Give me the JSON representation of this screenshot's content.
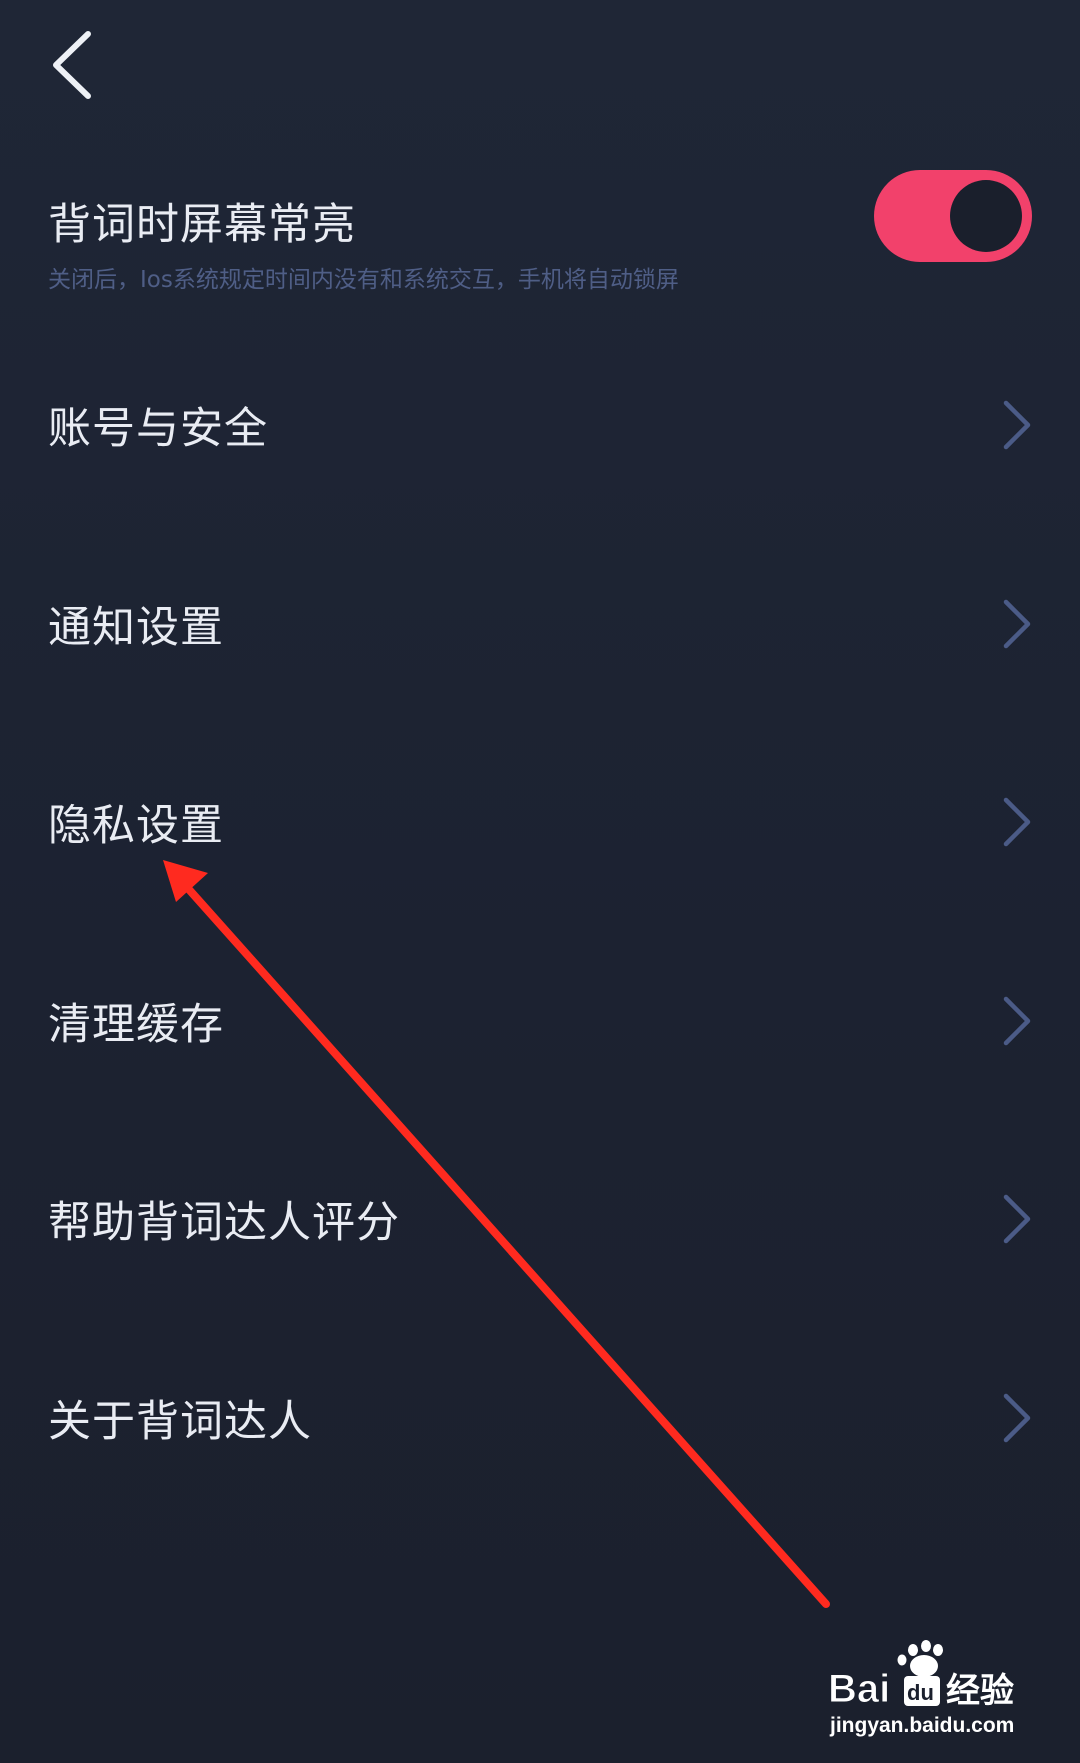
{
  "header": {
    "back_icon": "chevron-left-icon"
  },
  "screen_on_setting": {
    "title": "背词时屏幕常亮",
    "description": "关闭后，Ios系统规定时间内没有和系统交互，手机将自动锁屏",
    "enabled": true,
    "toggle_on_color": "#f2416b"
  },
  "menu": {
    "items": [
      {
        "label": "账号与安全"
      },
      {
        "label": "通知设置"
      },
      {
        "label": "隐私设置"
      },
      {
        "label": "清理缓存"
      },
      {
        "label": "帮助背词达人评分"
      },
      {
        "label": "关于背词达人"
      }
    ],
    "chevron_icon": "chevron-right-icon"
  },
  "annotation": {
    "color": "#ff2a1f",
    "target": "隐私设置"
  },
  "watermark": {
    "brand": "Bai",
    "brand_suffix": "du",
    "product": "经验",
    "url": "jingyan.baidu.com"
  }
}
